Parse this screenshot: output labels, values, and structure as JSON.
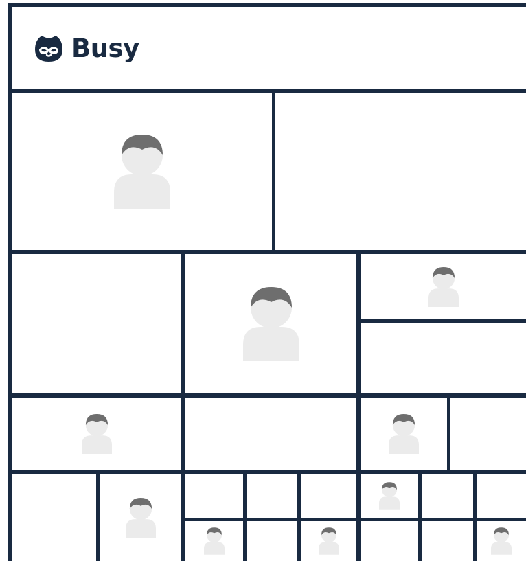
{
  "brand": {
    "name": "Busy",
    "color": "#192a41"
  },
  "colors": {
    "frame": "#192a41",
    "background": "#ffffff",
    "avatar_body": "#ebebeb",
    "avatar_hair": "#6e6e6e"
  },
  "icons": {
    "logo": "owl-logo-icon",
    "avatar": "person-placeholder-icon"
  },
  "tiles": [
    {
      "id": "tile-1",
      "has_avatar": true
    },
    {
      "id": "tile-2",
      "has_avatar": false
    },
    {
      "id": "tile-3",
      "has_avatar": false
    },
    {
      "id": "tile-4",
      "has_avatar": true
    },
    {
      "id": "tile-5",
      "has_avatar": true
    },
    {
      "id": "tile-6",
      "has_avatar": false
    },
    {
      "id": "tile-7",
      "has_avatar": true
    },
    {
      "id": "tile-8",
      "has_avatar": false
    },
    {
      "id": "tile-9",
      "has_avatar": true
    },
    {
      "id": "tile-10",
      "has_avatar": false
    },
    {
      "id": "tile-11",
      "has_avatar": false
    },
    {
      "id": "tile-12",
      "has_avatar": true
    },
    {
      "id": "tile-13",
      "has_avatar": false
    },
    {
      "id": "tile-14",
      "has_avatar": false
    },
    {
      "id": "tile-15",
      "has_avatar": false
    },
    {
      "id": "tile-16",
      "has_avatar": true
    },
    {
      "id": "tile-17",
      "has_avatar": false
    },
    {
      "id": "tile-18",
      "has_avatar": false
    },
    {
      "id": "tile-19",
      "has_avatar": true
    },
    {
      "id": "tile-20",
      "has_avatar": false
    },
    {
      "id": "tile-21",
      "has_avatar": true
    },
    {
      "id": "tile-22",
      "has_avatar": false
    },
    {
      "id": "tile-23",
      "has_avatar": false
    },
    {
      "id": "tile-24",
      "has_avatar": true
    }
  ]
}
